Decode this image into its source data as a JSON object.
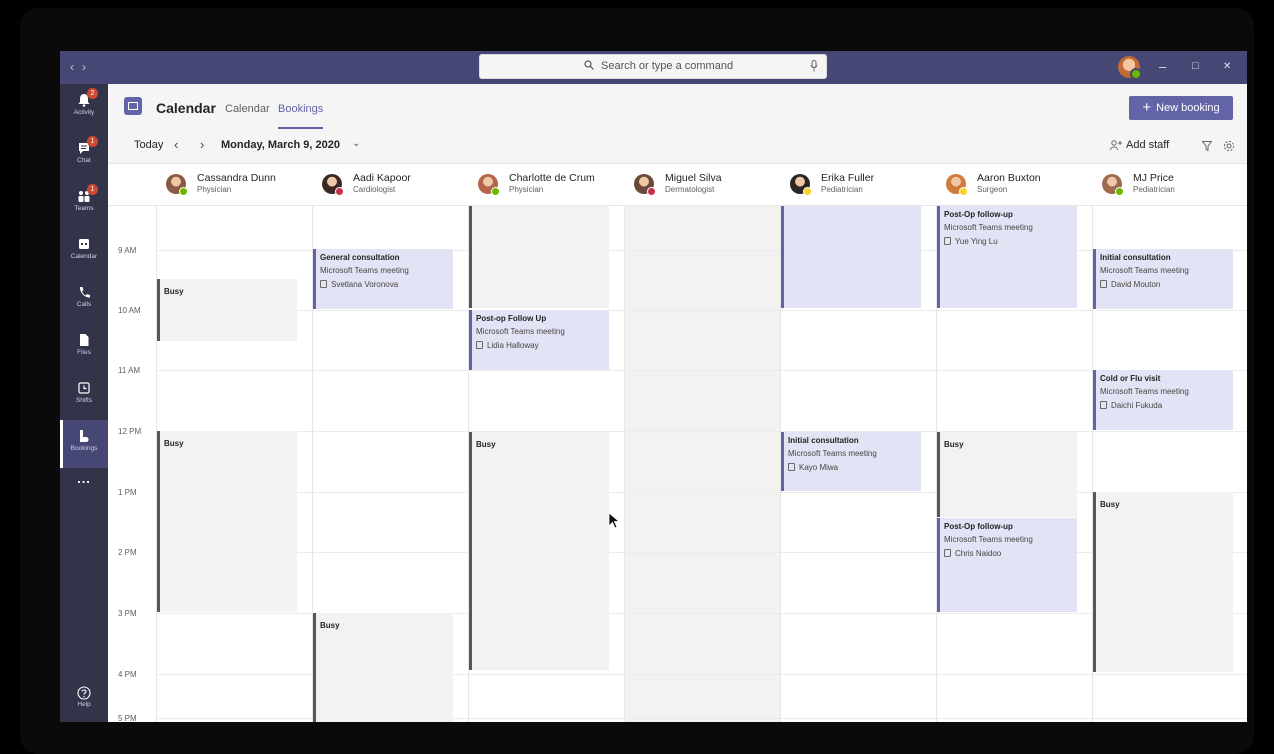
{
  "titlebar": {
    "search_placeholder": "Search or type a command",
    "nav_back": "‹",
    "nav_forward": "›",
    "minimize": "–",
    "maximize": "□",
    "close": "✕"
  },
  "rail": {
    "items": [
      {
        "label": "Activity",
        "icon": "bell-icon",
        "badge": "2"
      },
      {
        "label": "Chat",
        "icon": "chat-icon",
        "badge": "1"
      },
      {
        "label": "Teams",
        "icon": "teams-icon",
        "badge": "1"
      },
      {
        "label": "Calendar",
        "icon": "calendar-icon",
        "badge": ""
      },
      {
        "label": "Calls",
        "icon": "phone-icon",
        "badge": ""
      },
      {
        "label": "Files",
        "icon": "file-icon",
        "badge": ""
      },
      {
        "label": "Shifts",
        "icon": "clock-icon",
        "badge": ""
      },
      {
        "label": "Bookings",
        "icon": "bookings-icon",
        "badge": ""
      }
    ],
    "more": "...",
    "help": "Help"
  },
  "header": {
    "title": "Calendar",
    "tabs": [
      "Calendar",
      "Bookings"
    ],
    "active_tab": "Bookings",
    "new_booking_label": "New booking",
    "new_booking_plus": "+"
  },
  "toolbar": {
    "today": "Today",
    "prev": "‹",
    "next": "›",
    "date": "Monday, March 9, 2020",
    "dropdown": "⌄",
    "add_staff": "Add staff"
  },
  "staff": [
    {
      "name": "Cassandra Dunn",
      "role": "Physician",
      "status_color": "#6bb700"
    },
    {
      "name": "Aadi Kapoor",
      "role": "Cardiologist",
      "status_color": "#c4314b"
    },
    {
      "name": "Charlotte de Crum",
      "role": "Physician",
      "status_color": "#6bb700"
    },
    {
      "name": "Miguel Silva",
      "role": "Dermatologist",
      "status_color": "#c4314b"
    },
    {
      "name": "Erika Fuller",
      "role": "Pediatrician",
      "status_color": "#f8d22a"
    },
    {
      "name": "Aaron Buxton",
      "role": "Surgeon",
      "status_color": "#f8d22a"
    },
    {
      "name": "MJ Price",
      "role": "Pediatrician",
      "status_color": "#6bb700"
    }
  ],
  "times": [
    "9 AM",
    "10 AM",
    "11 AM",
    "12 PM",
    "1 PM",
    "2 PM",
    "3 PM",
    "4 PM",
    "5 PM"
  ],
  "events": [
    {
      "col": 0,
      "type": "busy",
      "title": "Busy"
    },
    {
      "col": 0,
      "type": "busy",
      "title": "Busy"
    },
    {
      "col": 1,
      "type": "booking",
      "title": "General consultation",
      "sub": "Microsoft Teams meeting",
      "person": "Svetlana Voronova"
    },
    {
      "col": 1,
      "type": "busy",
      "title": "Busy"
    },
    {
      "col": 2,
      "type": "busy",
      "title": ""
    },
    {
      "col": 2,
      "type": "booking",
      "title": "Post-op Follow Up",
      "sub": "Microsoft Teams meeting",
      "person": "Lidia Halloway"
    },
    {
      "col": 2,
      "type": "busy",
      "title": "Busy"
    },
    {
      "col": 4,
      "type": "booking",
      "title": "",
      "sub": "",
      "person": ""
    },
    {
      "col": 4,
      "type": "booking",
      "title": "Initial consultation",
      "sub": "Microsoft Teams meeting",
      "person": "Kayo Miwa"
    },
    {
      "col": 5,
      "type": "booking",
      "title": "Post-Op follow-up",
      "sub": "Microsoft Teams meeting",
      "person": "Yue Ying Lu"
    },
    {
      "col": 5,
      "type": "busy",
      "title": "Busy"
    },
    {
      "col": 5,
      "type": "booking",
      "title": "Post-Op follow-up",
      "sub": "Microsoft Teams meeting",
      "person": "Chris Naidoo"
    },
    {
      "col": 6,
      "type": "booking",
      "title": "Initial consultation",
      "sub": "Microsoft Teams meeting",
      "person": "David Mouton"
    },
    {
      "col": 6,
      "type": "booking",
      "title": "Cold or Flu visit",
      "sub": "Microsoft Teams meeting",
      "person": "Daichi Fukuda"
    },
    {
      "col": 6,
      "type": "busy",
      "title": "Busy"
    }
  ],
  "colors": {
    "accent": "#6264a7",
    "titlebar": "#464775",
    "rail": "#33344a",
    "booking_bg": "#e2e3f4",
    "busy_bg": "#f3f2f1"
  }
}
